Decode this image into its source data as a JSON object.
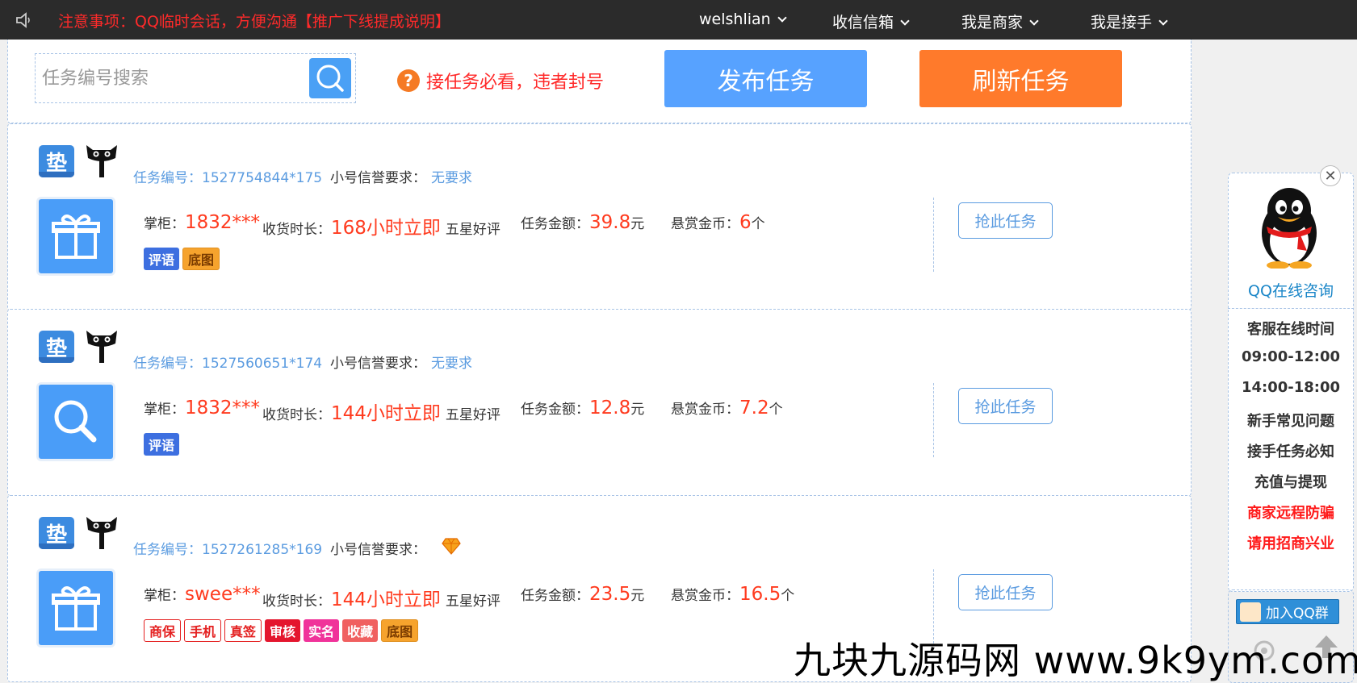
{
  "topbar": {
    "notice": "注意事项：QQ临时会话，方便沟通【推广下线提成说明】",
    "nav": [
      {
        "label": "welshlian"
      },
      {
        "label": "收信信箱"
      },
      {
        "label": "我是商家"
      },
      {
        "label": "我是接手"
      }
    ]
  },
  "search": {
    "placeholder": "任务编号搜索",
    "rules_link": "接任务必看，违者封号",
    "publish_label": "发布任务",
    "refresh_label": "刷新任务"
  },
  "labels": {
    "task_no": "任务编号：",
    "credit": "小号信誉要求：",
    "shopkeeper": "掌柜：",
    "receipt_time": "收货时长：",
    "five_star": "五星好评",
    "amount": "任务金额：",
    "amount_unit": "元",
    "reward": "悬赏金币：",
    "reward_unit": "个",
    "grab": "抢此任务",
    "pad_char": "垫"
  },
  "tasks": [
    {
      "task_no": "1527754844*175",
      "credit": "无要求",
      "shopkeeper": "1832***",
      "receipt_time": "168小时立即",
      "amount": "39.8",
      "reward": "6",
      "icon": "gift-icon",
      "tags": [
        {
          "label": "评语",
          "style": "blue"
        },
        {
          "label": "底图",
          "style": "yellow"
        }
      ]
    },
    {
      "task_no": "1527560651*174",
      "credit": "无要求",
      "shopkeeper": "1832***",
      "receipt_time": "144小时立即",
      "amount": "12.8",
      "reward": "7.2",
      "icon": "search-icon",
      "tags": [
        {
          "label": "评语",
          "style": "blue"
        }
      ]
    },
    {
      "task_no": "1527261285*169",
      "credit": "",
      "shopkeeper": "swee***",
      "receipt_time": "144小时立即",
      "amount": "23.5",
      "reward": "16.5",
      "icon": "gift-icon",
      "tags": [
        {
          "label": "商保",
          "style": "outline-red"
        },
        {
          "label": "手机",
          "style": "outline-red"
        },
        {
          "label": "真签",
          "style": "outline-red"
        },
        {
          "label": "审核",
          "style": "solid-red"
        },
        {
          "label": "实名",
          "style": "pink"
        },
        {
          "label": "收藏",
          "style": "salmon"
        },
        {
          "label": "底图",
          "style": "yellow"
        }
      ]
    }
  ],
  "side": {
    "qq_consult": "QQ在线咨询",
    "items": [
      {
        "label": "客服在线时间",
        "red": false
      },
      {
        "label": "09:00-12:00",
        "red": false
      },
      {
        "label": "14:00-18:00",
        "red": false
      },
      {
        "label": "新手常见问题",
        "red": false
      },
      {
        "label": "接手任务必知",
        "red": false
      },
      {
        "label": "充值与提现",
        "red": false
      },
      {
        "label": "商家远程防骗",
        "red": true
      },
      {
        "label": "请用招商兴业",
        "red": true
      }
    ],
    "join_qq": "加入QQ群",
    "close": "✕"
  },
  "watermark": "九块九源码网 www.9k9ym.com",
  "colors": {
    "accent_blue": "#57a2ff",
    "accent_orange": "#ff7a2b",
    "price_red": "#ff3b1f",
    "link_blue": "#5a9be0"
  }
}
